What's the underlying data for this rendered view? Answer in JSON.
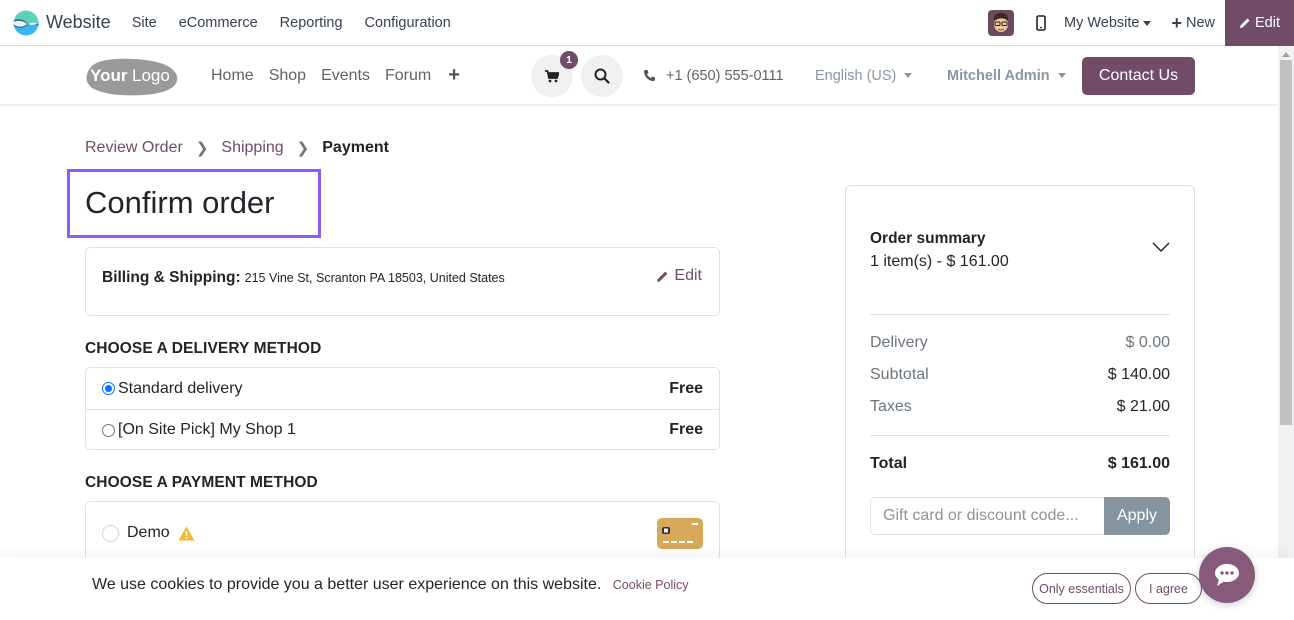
{
  "topbar": {
    "app_name": "Website",
    "menus": [
      "Site",
      "eCommerce",
      "Reporting",
      "Configuration"
    ],
    "website_selector": "My Website",
    "new_label": "New",
    "edit_label": "Edit"
  },
  "header": {
    "logo_text": "YourLogo",
    "nav": [
      "Home",
      "Shop",
      "Events",
      "Forum"
    ],
    "cart_count": "1",
    "phone": "+1 (650) 555-0111",
    "language": "English (US)",
    "user": "Mitchell Admin",
    "contact_label": "Contact Us"
  },
  "breadcrumb": {
    "items": [
      "Review Order",
      "Shipping"
    ],
    "active": "Payment"
  },
  "page": {
    "title": "Confirm order",
    "address_label": "Billing & Shipping:",
    "address_value": "215 Vine St, Scranton PA 18503, United States",
    "address_edit": "Edit"
  },
  "delivery": {
    "title": "CHOOSE A DELIVERY METHOD",
    "options": [
      {
        "label": "Standard delivery",
        "price": "Free",
        "selected": true
      },
      {
        "label": "[On Site Pick] My Shop 1",
        "price": "Free",
        "selected": false
      }
    ]
  },
  "payment": {
    "title": "CHOOSE A PAYMENT METHOD",
    "options": [
      {
        "label": "Demo",
        "warning": true,
        "icon": "credit-card-icon",
        "selected": false
      }
    ]
  },
  "summary": {
    "title": "Order summary",
    "count": "1 item(s) -  $ 161.00",
    "rows": [
      {
        "label": "Delivery",
        "value": "$ 0.00"
      },
      {
        "label": "Subtotal",
        "value": "$ 140.00"
      },
      {
        "label": "Taxes",
        "value": "$ 21.00"
      }
    ],
    "total_label": "Total",
    "total_value": "$ 161.00",
    "promo_placeholder": "Gift card or discount code...",
    "apply_label": "Apply"
  },
  "cookie": {
    "message": "We use cookies to provide you a better user experience on this website.",
    "policy_link": "Cookie Policy",
    "essentials_label": "Only essentials",
    "agree_label": "I agree"
  },
  "colors": {
    "brand": "#714b67",
    "highlight": "#8b5cf6",
    "apply_button": "#86949f",
    "radio_selected": "#0d6efd",
    "warning": "#f0ad4e"
  }
}
